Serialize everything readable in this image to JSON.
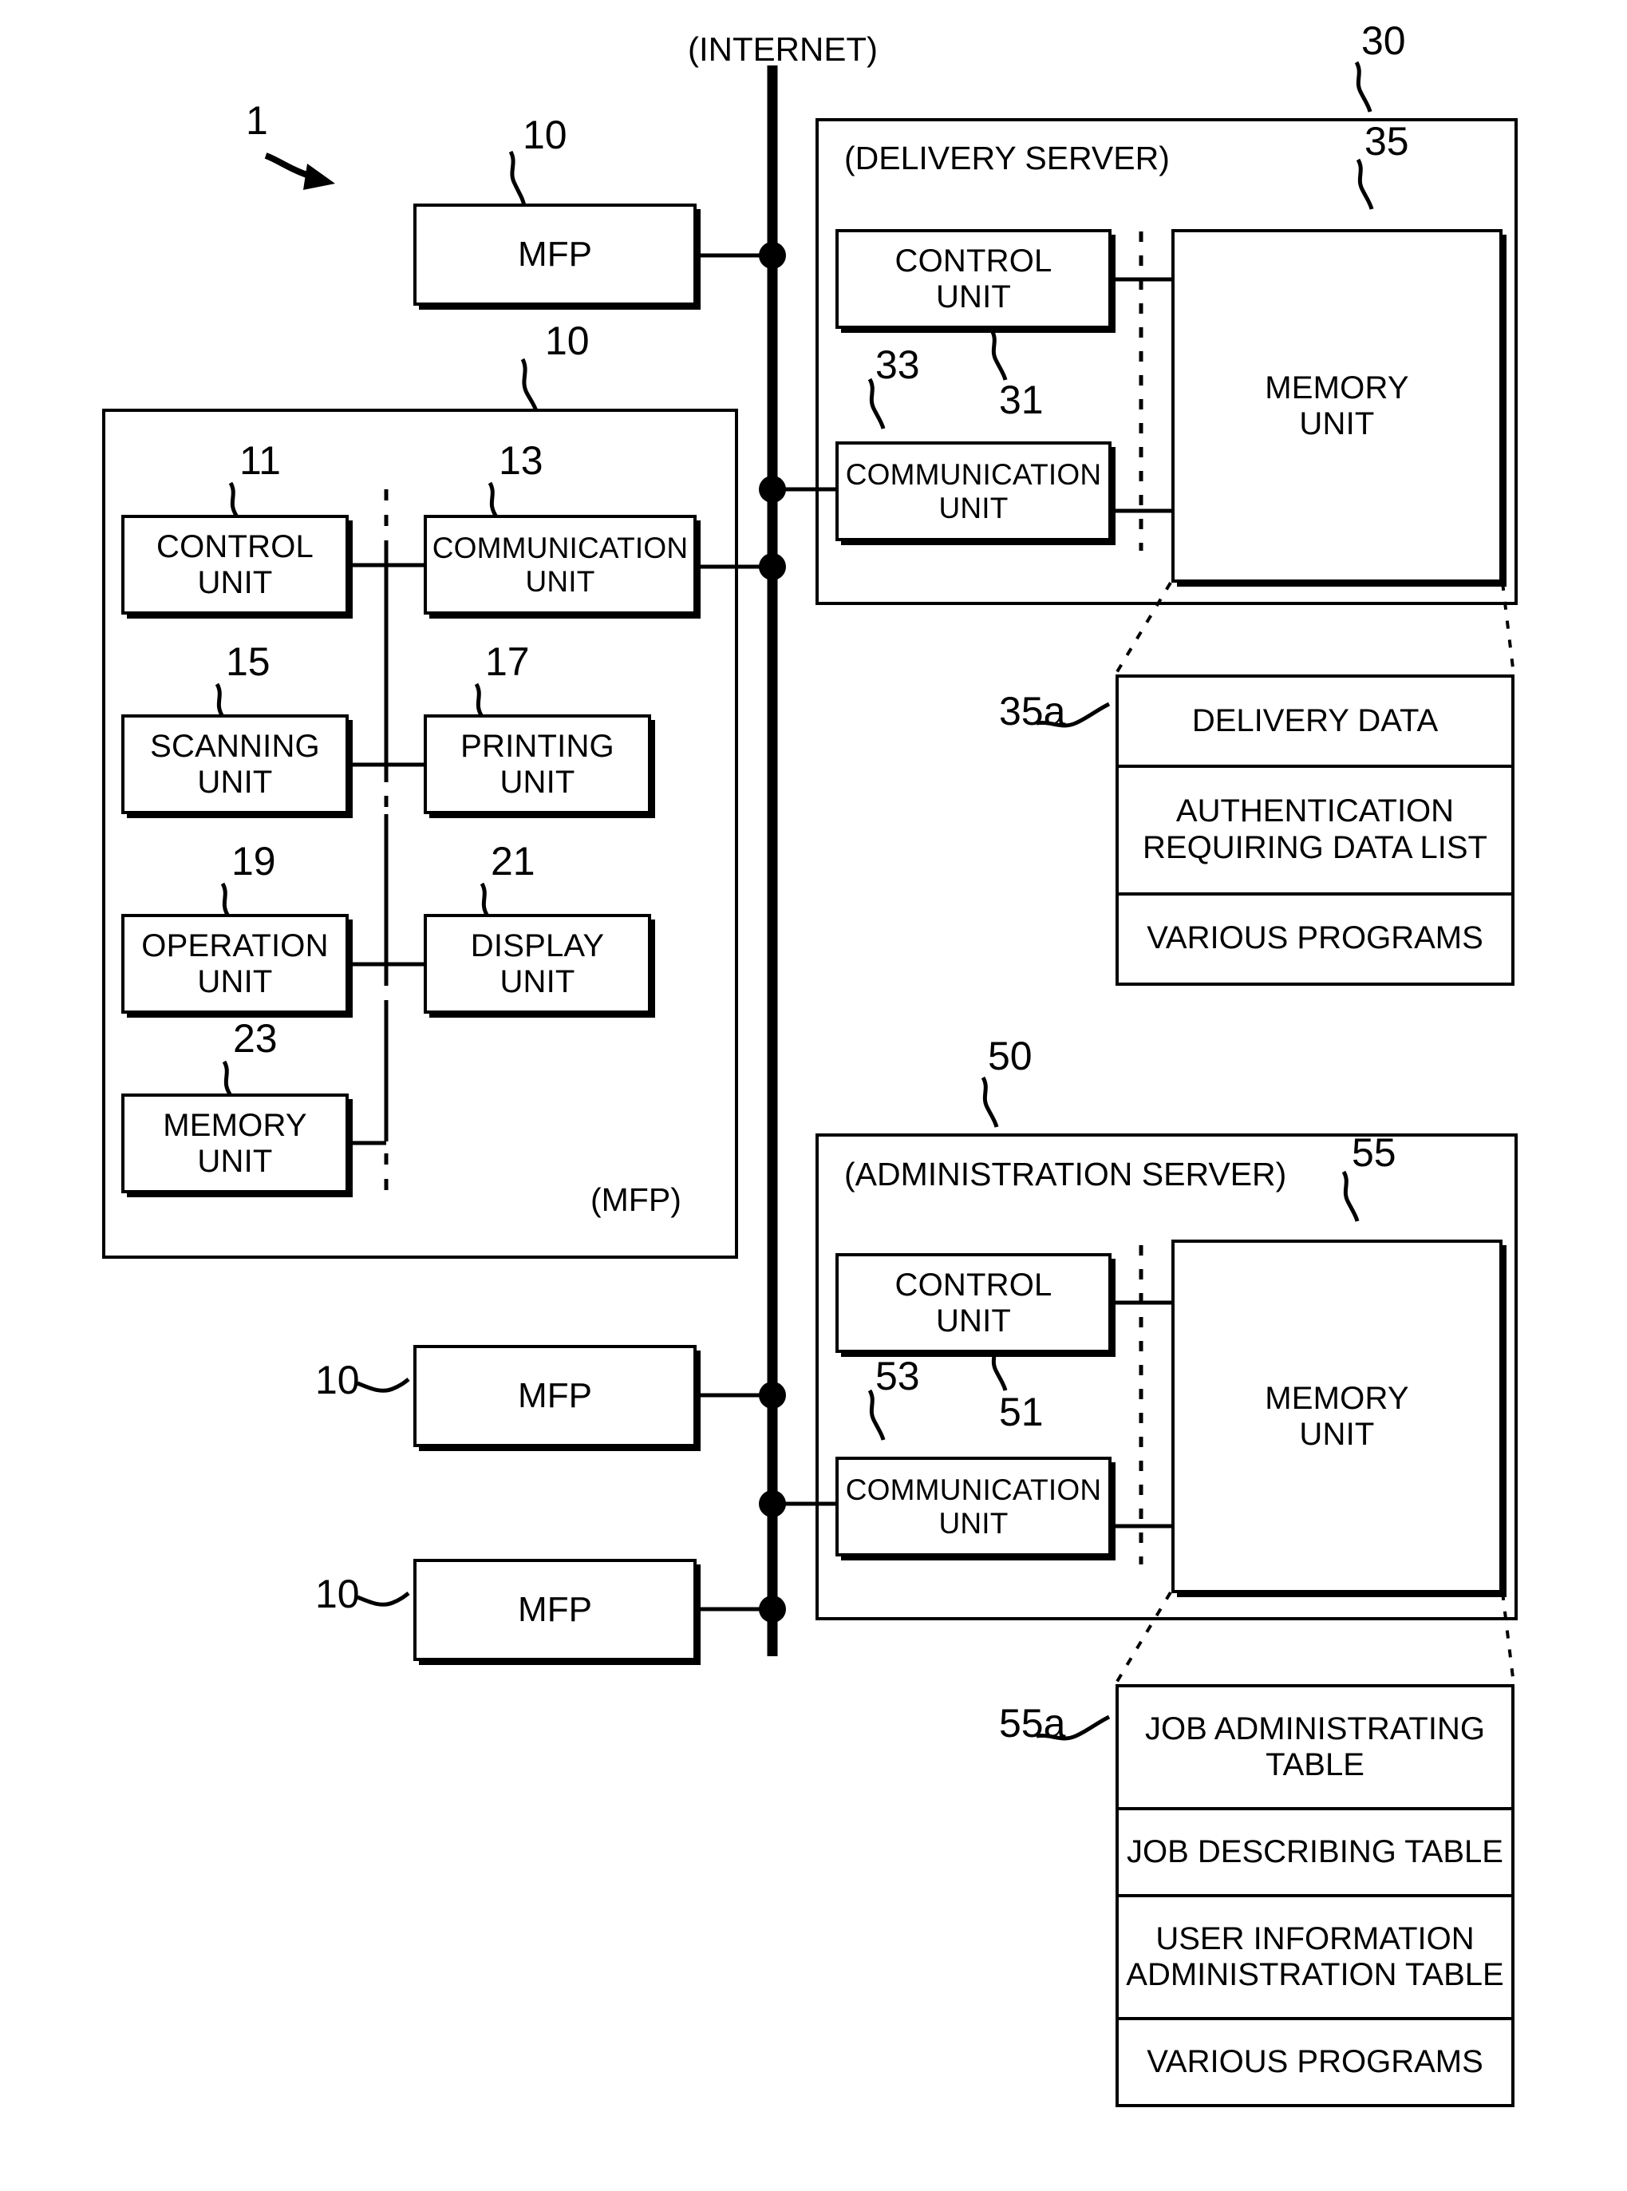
{
  "figure": {
    "system_ref": "1",
    "internet_label": "(INTERNET)"
  },
  "network": {
    "nodes": [
      {
        "name": "mfp-top",
        "label": "MFP",
        "ref": "10"
      },
      {
        "name": "mfp-middle",
        "label": "MFP",
        "ref": "10"
      },
      {
        "name": "mfp-bottom",
        "label": "MFP",
        "ref": "10"
      }
    ]
  },
  "mfp_detail": {
    "ref": "10",
    "caption": "(MFP)",
    "units": [
      {
        "name": "control-unit",
        "label": "CONTROL\nUNIT",
        "ref": "11"
      },
      {
        "name": "communication-unit",
        "label": "COMMUNICATION\nUNIT",
        "ref": "13"
      },
      {
        "name": "scanning-unit",
        "label": "SCANNING\nUNIT",
        "ref": "15"
      },
      {
        "name": "printing-unit",
        "label": "PRINTING\nUNIT",
        "ref": "17"
      },
      {
        "name": "operation-unit",
        "label": "OPERATION\nUNIT",
        "ref": "19"
      },
      {
        "name": "display-unit",
        "label": "DISPLAY\nUNIT",
        "ref": "21"
      },
      {
        "name": "memory-unit",
        "label": "MEMORY\nUNIT",
        "ref": "23"
      }
    ]
  },
  "delivery_server": {
    "ref": "30",
    "caption": "(DELIVERY SERVER)",
    "units": [
      {
        "name": "control-unit",
        "label": "CONTROL\nUNIT",
        "ref": "31"
      },
      {
        "name": "communication-unit",
        "label": "COMMUNICATION\nUNIT",
        "ref": "33"
      },
      {
        "name": "memory-unit",
        "label": "MEMORY\nUNIT",
        "ref": "35"
      }
    ],
    "memory_contents": {
      "ref": "35a",
      "rows": [
        "DELIVERY DATA",
        "AUTHENTICATION\nREQUIRING DATA LIST",
        "VARIOUS PROGRAMS"
      ]
    }
  },
  "administration_server": {
    "ref": "50",
    "caption": "(ADMINISTRATION SERVER)",
    "units": [
      {
        "name": "control-unit",
        "label": "CONTROL\nUNIT",
        "ref": "51"
      },
      {
        "name": "communication-unit",
        "label": "COMMUNICATION\nUNIT",
        "ref": "53"
      },
      {
        "name": "memory-unit",
        "label": "MEMORY\nUNIT",
        "ref": "55"
      }
    ],
    "memory_contents": {
      "ref": "55a",
      "rows": [
        "JOB ADMINISTRATING\nTABLE",
        "JOB DESCRIBING TABLE",
        "USER INFORMATION\nADMINISTRATION TABLE",
        "VARIOUS PROGRAMS"
      ]
    }
  }
}
